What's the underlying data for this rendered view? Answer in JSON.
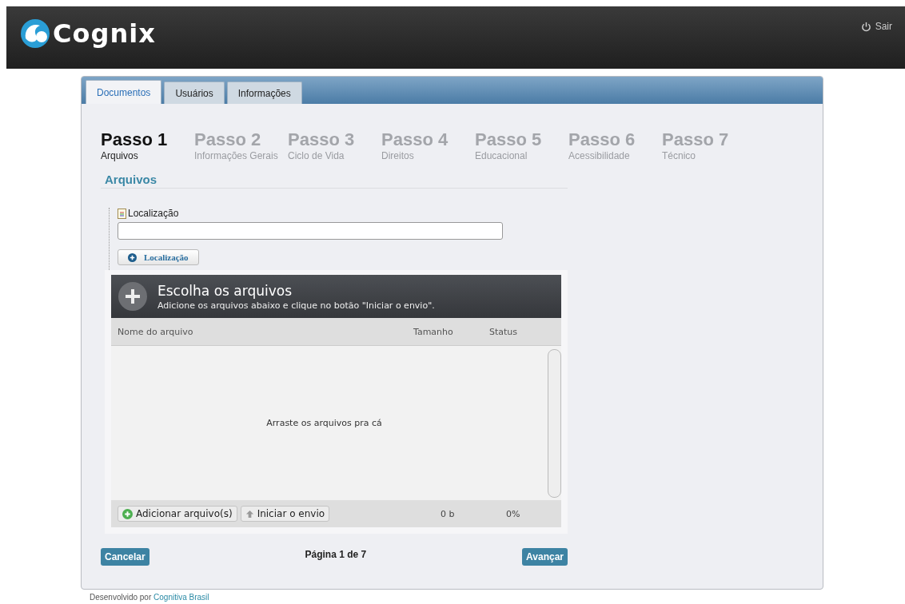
{
  "header": {
    "logo": "Cognix",
    "logout": "Sair"
  },
  "tabs": [
    {
      "label": "Documentos",
      "selected": true
    },
    {
      "label": "Usuários",
      "selected": false
    },
    {
      "label": "Informações",
      "selected": false
    }
  ],
  "steps": [
    {
      "title": "Passo 1",
      "subtitle": "Arquivos",
      "selected": true
    },
    {
      "title": "Passo 2",
      "subtitle": "Informações Gerais",
      "selected": false
    },
    {
      "title": "Passo 3",
      "subtitle": "Ciclo de Vida",
      "selected": false
    },
    {
      "title": "Passo 4",
      "subtitle": "Direitos",
      "selected": false
    },
    {
      "title": "Passo 5",
      "subtitle": "Educacional",
      "selected": false
    },
    {
      "title": "Passo 6",
      "subtitle": "Acessibilidade",
      "selected": false
    },
    {
      "title": "Passo 7",
      "subtitle": "Técnico",
      "selected": false
    }
  ],
  "section_title": "Arquivos",
  "location": {
    "label": "Localização",
    "button": "Localização"
  },
  "uploader": {
    "title": "Escolha os arquivos",
    "subtitle": "Adicione os arquivos abaixo e clique no botão \"Iniciar o envio\".",
    "columns": [
      "Nome do arquivo",
      "Tamanho",
      "Status"
    ],
    "drop_hint": "Arraste os arquivos pra cá",
    "add_button": "Adicionar arquivo(s)",
    "start_button": "Iniciar o envio",
    "total_size": "0 b",
    "total_status": "0%"
  },
  "nav": {
    "cancel": "Cancelar",
    "page": "Página 1 de 7",
    "next": "Avançar"
  },
  "footer": {
    "text": "Desenvolvido por",
    "link": "Cognitiva Brasil"
  }
}
